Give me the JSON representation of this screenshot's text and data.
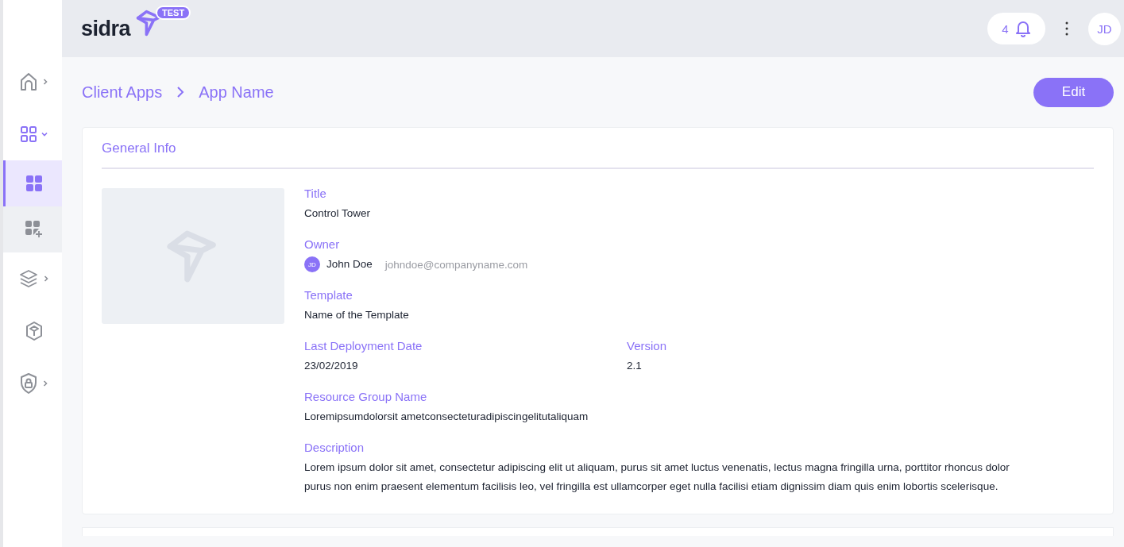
{
  "header": {
    "logo": "sidra",
    "badge": "TEST",
    "notifications": {
      "count": "4"
    },
    "avatar": "JD"
  },
  "sidebar": {
    "items": [
      {
        "kind": "menu",
        "expanded": false,
        "selected": false
      },
      {
        "kind": "menu",
        "expanded": true,
        "selected": false
      },
      {
        "kind": "submenu",
        "selected": true
      },
      {
        "kind": "submenu",
        "selected": false
      },
      {
        "kind": "menu",
        "expanded": false,
        "selected": false
      },
      {
        "kind": "plain",
        "selected": false
      },
      {
        "kind": "menu",
        "expanded": false,
        "selected": false
      }
    ]
  },
  "breadcrumb": [
    "Client Apps",
    "App Name"
  ],
  "edit_button": "Edit",
  "card": {
    "title": "General Info",
    "image": {
      "kind": "placeholder"
    },
    "rows": [
      [
        {
          "kind": "text",
          "label": "Title",
          "value": "Control Tower"
        }
      ],
      [
        {
          "kind": "person",
          "label": "Owner",
          "initials": "JD",
          "name": "John Doe",
          "email": "johndoe@companyname.com"
        }
      ],
      [
        {
          "kind": "text",
          "label": "Template",
          "value": "Name of the Template"
        }
      ],
      [
        {
          "kind": "text",
          "label": "Last Deployment Date",
          "value": "23/02/2019"
        },
        {
          "kind": "text",
          "label": "Version",
          "value": "2.1"
        }
      ],
      [
        {
          "kind": "text",
          "label": "Resource Group Name",
          "value": "Loremipsumdolorsit ametconsecteturadipiscingelitutaliquam"
        }
      ],
      [
        {
          "kind": "text",
          "label": "Description",
          "value": "Lorem ipsum dolor sit amet, consectetur adipiscing elit ut aliquam, purus sit amet luctus venenatis, lectus magna fringilla urna, porttitor rhoncus dolor purus non enim praesent elementum facilisis leo, vel fringilla est ullamcorper eget nulla facilisi etiam dignissim diam quis enim lobortis scelerisque."
        }
      ]
    ]
  }
}
